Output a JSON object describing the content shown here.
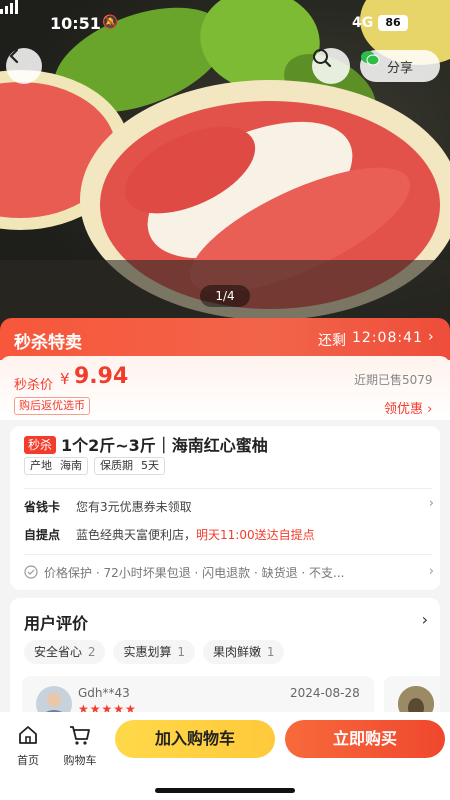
{
  "status_bar": {
    "time": "10:51",
    "network": "4G",
    "battery": "86"
  },
  "header": {
    "share_label": "分享"
  },
  "gallery": {
    "page_indicator": "1/4"
  },
  "flash_sale": {
    "title": "秒杀特卖",
    "remain_label": "还剩",
    "countdown": "12:08:41"
  },
  "price": {
    "label": "秒杀价",
    "currency": "¥",
    "value": "9.94",
    "sold": "近期已售5079",
    "rebate_tag": "购后返优选币",
    "coupon_link": "领优惠 ›"
  },
  "product": {
    "sale_badge": "秒杀",
    "title": "1个2斤~3斤｜海南红心蜜柚",
    "specs": [
      {
        "key": "产地",
        "value": "海南"
      },
      {
        "key": "保质期",
        "value": "5天"
      }
    ],
    "money_card": {
      "label": "省钱卡",
      "text": "您有3元优惠券未领取"
    },
    "pickup": {
      "label": "自提点",
      "text": "蓝色经典天富便利店，",
      "highlight": "明天11:00送达自提点"
    },
    "guarantees": "价格保护 · 72小时坏果包退 · 闪电退款 · 缺货退 · 不支..."
  },
  "reviews": {
    "title": "用户评价",
    "tags": [
      {
        "label": "安全省心",
        "count": "2"
      },
      {
        "label": "实惠划算",
        "count": "1"
      },
      {
        "label": "果肉鲜嫩",
        "count": "1"
      }
    ],
    "items": [
      {
        "name": "Gdh**43",
        "date": "2024-08-28",
        "stars": "★★★★★"
      }
    ]
  },
  "bottom_nav": {
    "home_label": "首页",
    "cart_label": "购物车",
    "add_cart_label": "加入购物车",
    "buy_now_label": "立即购买"
  },
  "colors": {
    "accent": "#f23c2c",
    "banner": "#f7573a",
    "cart_button": "#ffd94a"
  }
}
